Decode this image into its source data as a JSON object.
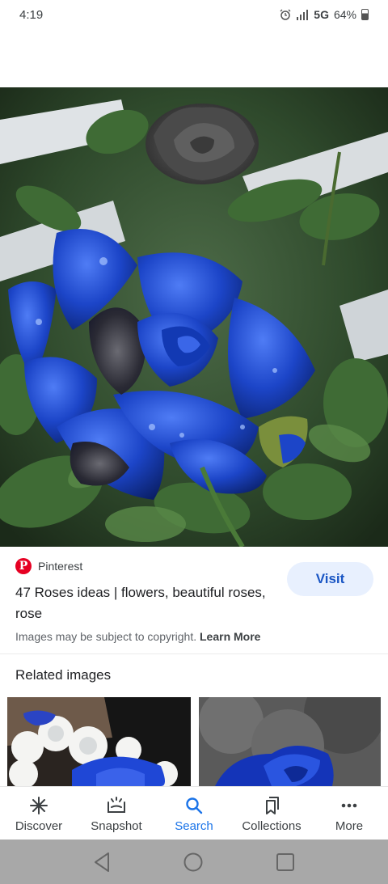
{
  "status_bar": {
    "time": "4:19",
    "network": "5G",
    "battery": "64%",
    "alarm_icon": "alarm-icon",
    "signal_icon": "signal-icon",
    "battery_icon": "battery-icon"
  },
  "hero": {
    "image_icon": "rose-photo"
  },
  "result": {
    "source_name": "Pinterest",
    "source_icon": "pinterest-logo",
    "title": "47 Roses ideas | flowers, beautiful roses, rose",
    "visit_label": "Visit",
    "copyright_text": "Images may be subject to copyright.",
    "learn_more": "Learn More"
  },
  "related": {
    "heading": "Related images"
  },
  "bottom_nav": {
    "items": [
      {
        "label": "Discover",
        "icon": "asterisk-icon"
      },
      {
        "label": "Snapshot",
        "icon": "snapshot-icon"
      },
      {
        "label": "Search",
        "icon": "search-icon",
        "active": true
      },
      {
        "label": "Collections",
        "icon": "bookmarks-icon"
      },
      {
        "label": "More",
        "icon": "more-dots-icon"
      }
    ]
  },
  "colors": {
    "accent": "#1a73e8",
    "pinterest": "#e60023",
    "visit_bg": "#e8f0fe",
    "system_bar": "#a8a8a8"
  }
}
